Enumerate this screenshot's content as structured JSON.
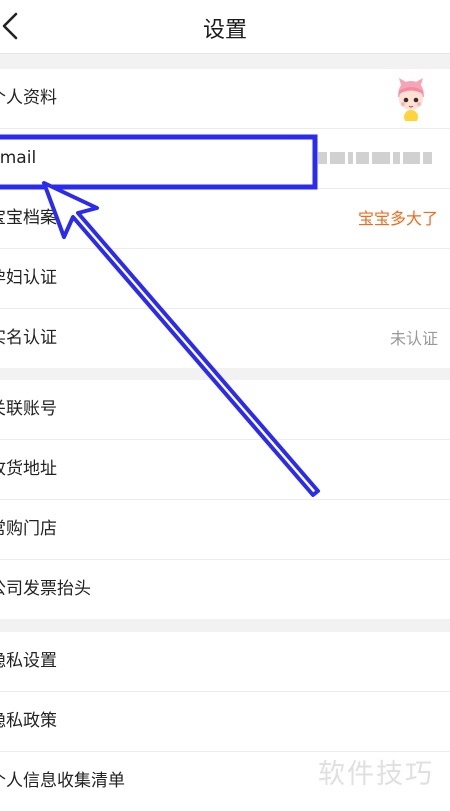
{
  "header": {
    "title": "设置",
    "back_icon": "chevron-left-icon"
  },
  "group1": {
    "profile": {
      "label": "个人资料",
      "avatar_icon": "cartoon-avatar-icon"
    },
    "email": {
      "label": "Email"
    },
    "baby": {
      "label": "宝宝档案",
      "value": "宝宝多大了"
    },
    "pregnant": {
      "label": "孕妇认证"
    },
    "realname": {
      "label": "实名认证",
      "value": "未认证"
    }
  },
  "group2": {
    "linked": {
      "label": "关联账号"
    },
    "address": {
      "label": "收货地址"
    },
    "store": {
      "label": "常购门店"
    },
    "invoice": {
      "label": "公司发票抬头"
    }
  },
  "group3": {
    "privacy_settings": {
      "label": "隐私设置"
    },
    "privacy_policy": {
      "label": "隐私政策"
    },
    "info_list": {
      "label": "个人信息收集清单"
    }
  },
  "watermark": "软件技巧",
  "colors": {
    "accent_orange": "#f26b1d",
    "annotation_blue": "#2b2bf0",
    "muted": "#999999"
  }
}
